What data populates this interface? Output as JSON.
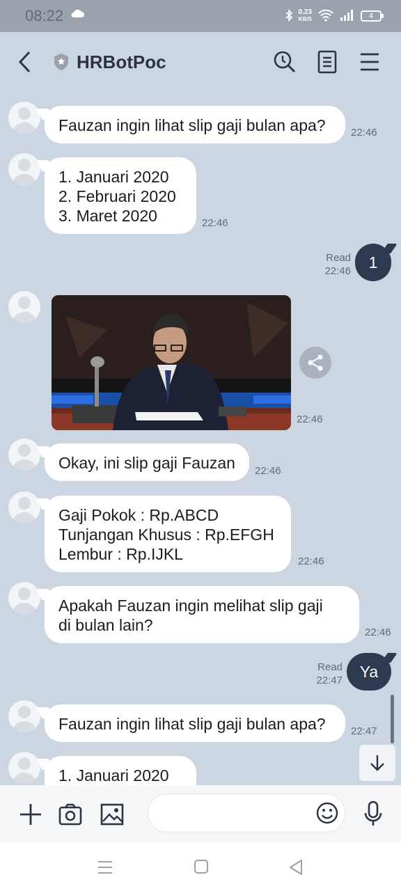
{
  "status_bar": {
    "time": "08:22",
    "net_speed_value": "0.23",
    "net_speed_unit": "KB/S",
    "battery": "4",
    "icons": [
      "cloud-icon",
      "bluetooth-icon",
      "wifi-icon",
      "signal-icon",
      "battery-icon"
    ]
  },
  "header": {
    "title": "HRBotPoc",
    "icons": [
      "back-icon",
      "shield-icon",
      "search-icon",
      "notes-icon",
      "menu-icon"
    ]
  },
  "messages": [
    {
      "from": "bot",
      "lines": [
        "Fauzan ingin lihat slip gaji bulan apa?"
      ],
      "time": "22:46"
    },
    {
      "from": "bot",
      "lines": [
        "1. Januari 2020",
        "2. Februari 2020",
        "3. Maret 2020"
      ],
      "time": "22:46"
    },
    {
      "from": "me",
      "text": "1",
      "status": "Read",
      "time": "22:46"
    },
    {
      "from": "bot",
      "type": "image",
      "time": "22:46"
    },
    {
      "from": "bot",
      "lines": [
        "Okay, ini slip gaji Fauzan"
      ],
      "time": "22:46"
    },
    {
      "from": "bot",
      "lines": [
        "Gaji Pokok : Rp.ABCD",
        "Tunjangan Khusus : Rp.EFGH",
        "Lembur : Rp.IJKL"
      ],
      "time": "22:46"
    },
    {
      "from": "bot",
      "lines": [
        "Apakah Fauzan ingin melihat slip gaji",
        "di bulan lain?"
      ],
      "time": "22:46"
    },
    {
      "from": "me",
      "text": "Ya",
      "status": "Read",
      "time": "22:47"
    },
    {
      "from": "bot",
      "lines": [
        "Fauzan ingin lihat slip gaji bulan apa?"
      ],
      "time": "22:47"
    },
    {
      "from": "bot",
      "lines": [
        "1. Januari 2020"
      ]
    }
  ],
  "composer": {
    "icons": [
      "plus-icon",
      "camera-icon",
      "gallery-icon",
      "emoji-icon",
      "mic-icon"
    ],
    "input_placeholder": ""
  },
  "colors": {
    "background": "#ccd5e2",
    "my_bubble": "#2e3a4f",
    "bot_bubble": "#ffffff"
  }
}
